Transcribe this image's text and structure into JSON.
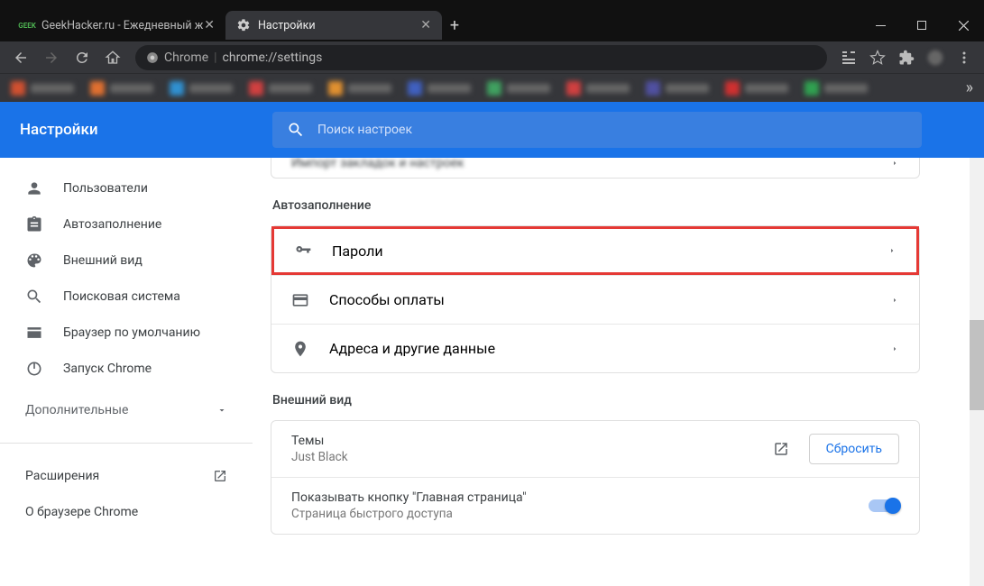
{
  "tabs": [
    {
      "title": "GeekHacker.ru - Ежедневный ж",
      "fav_text": "GEEK",
      "active": false
    },
    {
      "title": "Настройки",
      "active": true
    }
  ],
  "omnibox": {
    "prefix": "Chrome",
    "path": "chrome://settings"
  },
  "settings": {
    "title": "Настройки"
  },
  "search": {
    "placeholder": "Поиск настроек"
  },
  "sidebar": {
    "items": [
      {
        "label": "Пользователи"
      },
      {
        "label": "Автозаполнение"
      },
      {
        "label": "Внешний вид"
      },
      {
        "label": "Поисковая система"
      },
      {
        "label": "Браузер по умолчанию"
      },
      {
        "label": "Запуск Chrome"
      }
    ],
    "advanced": "Дополнительные",
    "extensions": "Расширения",
    "about": "О браузере Chrome"
  },
  "main": {
    "import_cut": "Импорт закладок и настроек",
    "autofill": {
      "title": "Автозаполнение",
      "rows": [
        {
          "label": "Пароли"
        },
        {
          "label": "Способы оплаты"
        },
        {
          "label": "Адреса и другие данные"
        }
      ]
    },
    "appearance": {
      "title": "Внешний вид",
      "theme": {
        "label": "Темы",
        "value": "Just Black",
        "reset": "Сбросить"
      },
      "homebtn": {
        "label": "Показывать кнопку \"Главная страница\"",
        "sub": "Страница быстрого доступа"
      }
    }
  }
}
